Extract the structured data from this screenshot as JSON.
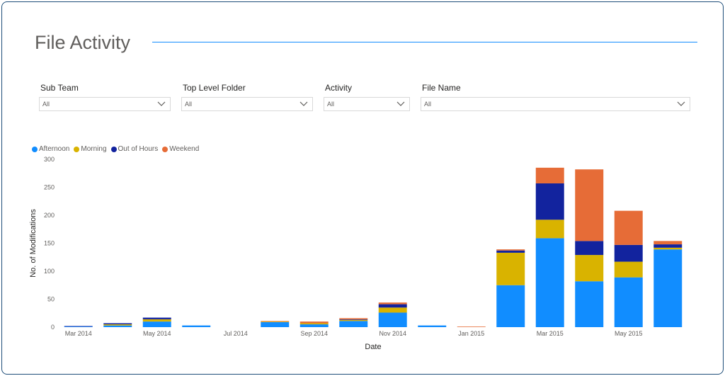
{
  "page": {
    "title": "File Activity"
  },
  "slicers": [
    {
      "label": "Sub Team",
      "value": "All"
    },
    {
      "label": "Top Level Folder",
      "value": "All"
    },
    {
      "label": "Activity",
      "value": "All"
    },
    {
      "label": "File Name",
      "value": "All"
    }
  ],
  "colors": {
    "Afternoon": "#118dff",
    "Morning": "#d9b300",
    "Out of Hours": "#12239e",
    "Weekend": "#e66c37"
  },
  "chart_data": {
    "type": "bar",
    "stacked": true,
    "xlabel": "Date",
    "ylabel": "No. of Modifications",
    "ylim": [
      0,
      300
    ],
    "yticks": [
      0,
      50,
      100,
      150,
      200,
      250,
      300
    ],
    "grid": false,
    "legend_position": "top-left",
    "categories": [
      "Mar 2014",
      "Apr 2014",
      "May 2014",
      "Jun 2014",
      "Jul 2014",
      "Aug 2014",
      "Sep 2014",
      "Oct 2014",
      "Nov 2014",
      "Dec 2014",
      "Jan 2015",
      "Feb 2015",
      "Mar 2015",
      "Apr 2015",
      "May 2015",
      "Jun 2015"
    ],
    "tick_labels": [
      "Mar 2014",
      "",
      "May 2014",
      "",
      "Jul 2014",
      "",
      "Sep 2014",
      "",
      "Nov 2014",
      "",
      "Jan 2015",
      "",
      "Mar 2015",
      "",
      "May 2015",
      ""
    ],
    "series": [
      {
        "name": "Afternoon",
        "values": [
          1,
          3,
          10,
          3,
          0,
          9,
          5,
          11,
          26,
          3,
          0,
          75,
          159,
          82,
          89,
          139
        ]
      },
      {
        "name": "Morning",
        "values": [
          0,
          2,
          4,
          0,
          0,
          1,
          2,
          2,
          9,
          0,
          0,
          58,
          33,
          47,
          28,
          3
        ]
      },
      {
        "name": "Out of Hours",
        "values": [
          1,
          2,
          3,
          0,
          0,
          0,
          0,
          1,
          6,
          0,
          0,
          4,
          65,
          25,
          30,
          6
        ]
      },
      {
        "name": "Weekend",
        "values": [
          0,
          0,
          0,
          0,
          0,
          1,
          3,
          2,
          3,
          0,
          1,
          2,
          28,
          128,
          61,
          6
        ]
      }
    ]
  }
}
